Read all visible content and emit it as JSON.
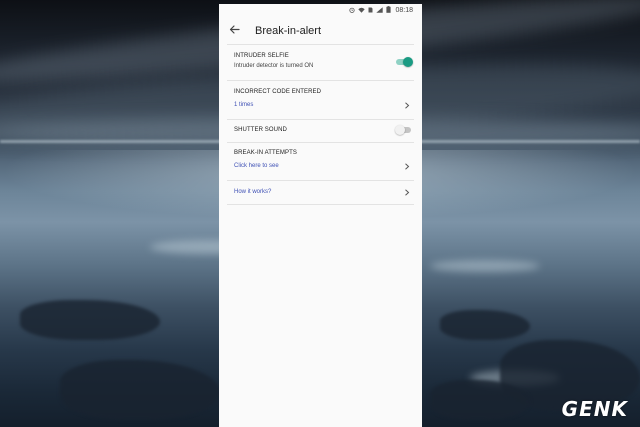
{
  "status_bar": {
    "time": "08:18",
    "icons": [
      "alarm-icon",
      "wifi-icon",
      "sim-icon",
      "signal-icon",
      "battery-icon"
    ]
  },
  "app_bar": {
    "title": "Break-in-alert",
    "back_icon": "arrow-left-icon"
  },
  "settings": {
    "intruder_selfie": {
      "title": "INTRUDER SELFIE",
      "subtitle": "Intruder detector is turned ON",
      "enabled": true
    },
    "incorrect_code": {
      "title": "INCORRECT CODE ENTERED",
      "value": "1 times"
    },
    "shutter_sound": {
      "title": "SHUTTER SOUND",
      "enabled": false
    },
    "break_in_attempts": {
      "title": "BREAK-IN ATTEMPTS",
      "link": "Click here to see"
    },
    "how_it_works": {
      "link": "How it works?"
    }
  },
  "colors": {
    "accent": "#1a9b83",
    "link": "#3f51b5"
  },
  "watermark": "GENK"
}
